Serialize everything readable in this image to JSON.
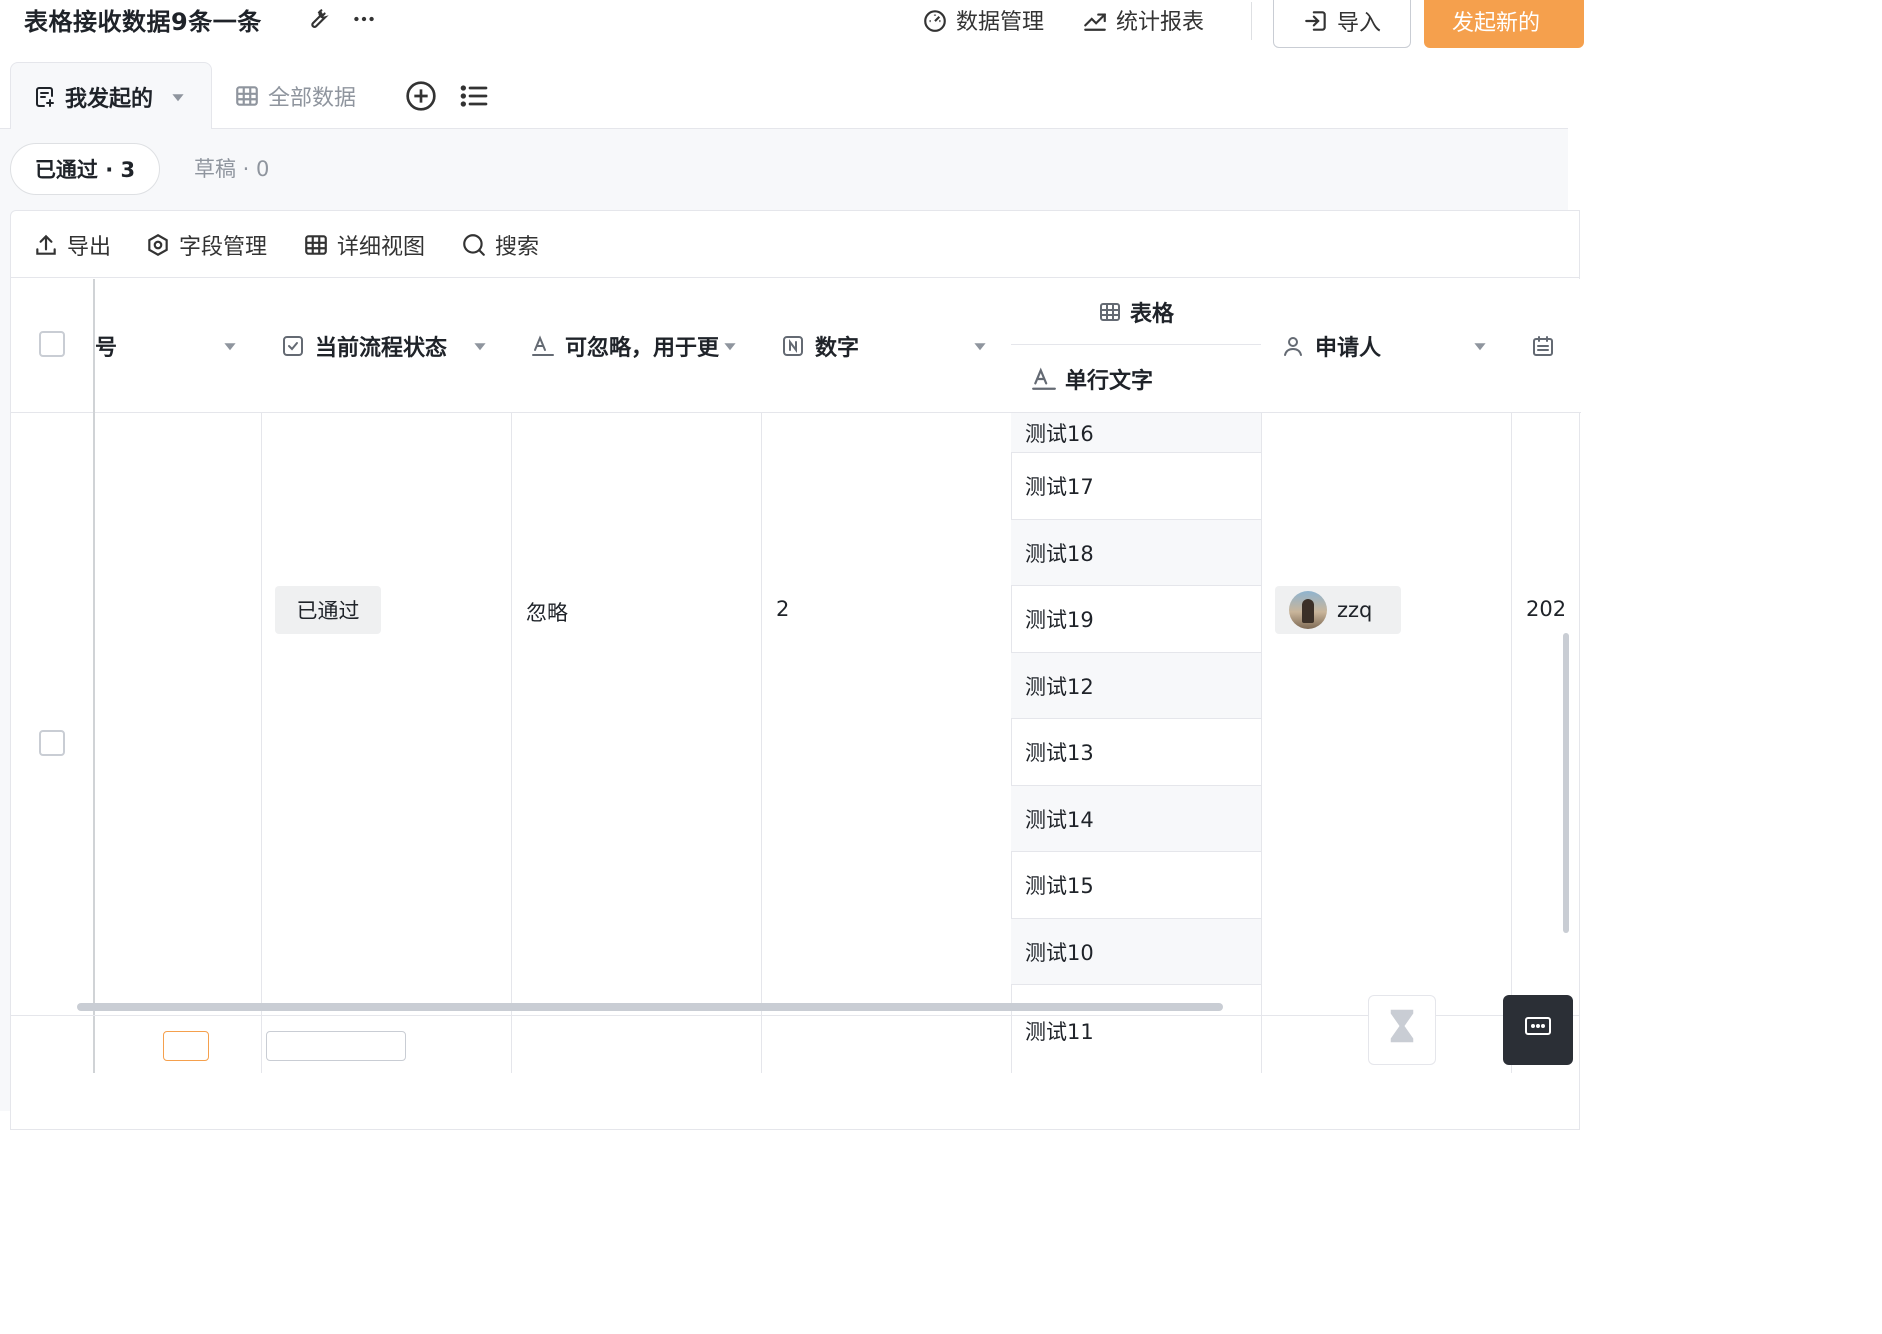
{
  "app": {
    "title": "表格接收数据9条一条"
  },
  "header": {
    "data_manage": "数据管理",
    "report": "统计报表",
    "import": "导入",
    "new": "发起新的"
  },
  "views": {
    "active": "我发起的",
    "all": "全部数据"
  },
  "filters": {
    "approved": "已通过 · 3",
    "draft": "草稿 · 0"
  },
  "toolbar": {
    "export": "导出",
    "fields": "字段管理",
    "detail": "详细视图",
    "search": "搜索"
  },
  "columns": {
    "serial": "号",
    "status": "当前流程状态",
    "ignorable": "可忽略，用于更",
    "number": "数字",
    "table_group": "表格",
    "single_text": "单行文字",
    "applicant": "申请人"
  },
  "row": {
    "status": "已通过",
    "ignorable": "忽略",
    "number": "2",
    "applicant": "zzq",
    "date_partial": "202",
    "sub_values": [
      "测试16",
      "测试17",
      "测试18",
      "测试19",
      "测试12",
      "测试13",
      "测试14",
      "测试15",
      "测试10",
      "测试11"
    ]
  },
  "colors": {
    "accent": "#f5a04d"
  }
}
